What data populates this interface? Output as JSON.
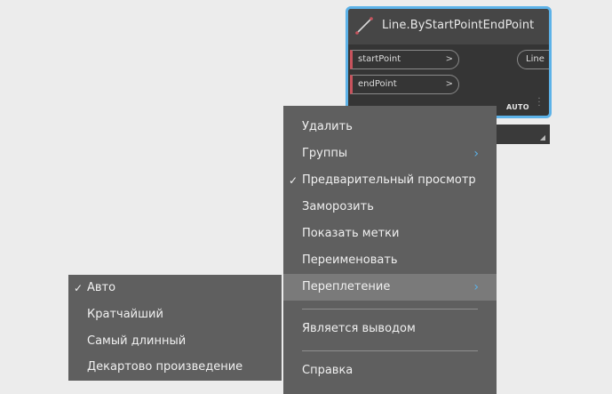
{
  "node": {
    "title": "Line.ByStartPointEndPoint",
    "icon": "line-icon",
    "inputs": [
      {
        "label": "startPoint",
        "chevron": ">"
      },
      {
        "label": "endPoint",
        "chevron": ">"
      }
    ],
    "output": "Line",
    "lacing": "AUTO",
    "colors": {
      "border": "#5cb2e8",
      "port_marker": "#c8535d"
    }
  },
  "context_menu": {
    "items": [
      {
        "label": "Удалить"
      },
      {
        "label": "Группы",
        "arrow": "›"
      },
      {
        "label": "Предварительный просмотр",
        "check": "✓"
      },
      {
        "label": "Заморозить"
      },
      {
        "label": "Показать метки"
      },
      {
        "label": "Переименовать"
      },
      {
        "label": "Переплетение",
        "arrow": "›"
      },
      {
        "label": "Является выводом"
      },
      {
        "label": "Справка"
      }
    ]
  },
  "lacing_submenu": {
    "items": [
      {
        "label": "Авто",
        "check": "✓"
      },
      {
        "label": "Кратчайший"
      },
      {
        "label": "Самый длинный"
      },
      {
        "label": "Декартово произведение"
      }
    ]
  }
}
